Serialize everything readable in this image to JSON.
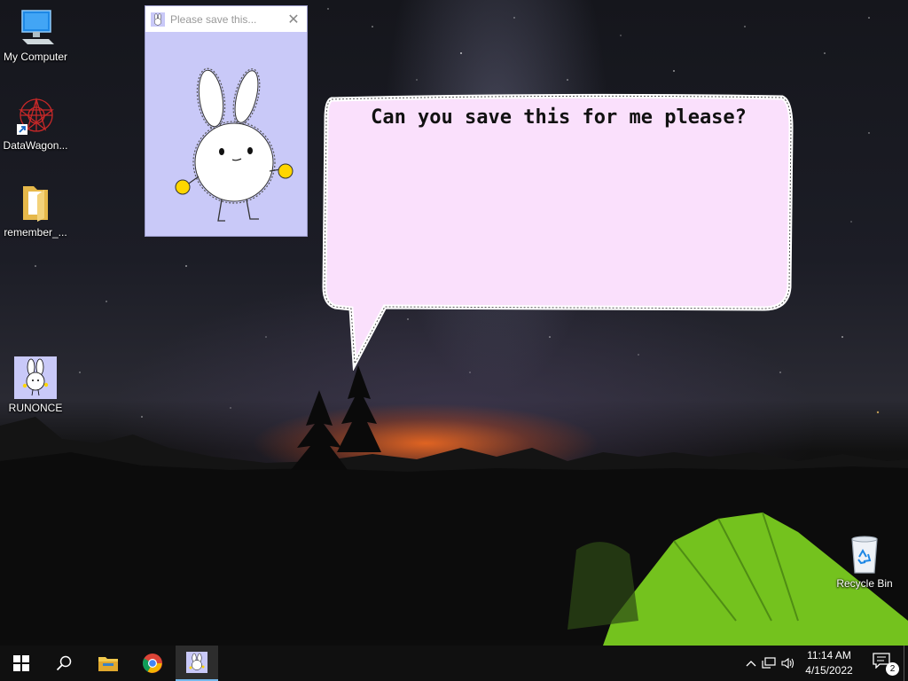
{
  "desktop": {
    "icons": [
      {
        "label": "My Computer",
        "icon": "computer-icon"
      },
      {
        "label": "DataWagon...",
        "icon": "datawagon-shortcut-icon"
      },
      {
        "label": "remember_...",
        "icon": "folder-icon"
      },
      {
        "label": "RUNONCE",
        "icon": "bunny-app-icon"
      },
      {
        "label": "Recycle Bin",
        "icon": "recycle-bin-icon"
      }
    ]
  },
  "bunny_window": {
    "title": "Please save this...",
    "close_symbol": "✕",
    "background": "#c9c9f8"
  },
  "speech_bubble": {
    "text": "Can you save this for me please?",
    "fill": "#fae0fc"
  },
  "taskbar": {
    "apps": [
      {
        "name": "start",
        "icon": "windows-logo-icon"
      },
      {
        "name": "search",
        "icon": "search-icon"
      },
      {
        "name": "file-explorer",
        "icon": "folder-icon"
      },
      {
        "name": "chrome",
        "icon": "chrome-icon"
      },
      {
        "name": "runonce",
        "icon": "bunny-app-icon",
        "active": true
      }
    ],
    "clock": {
      "time": "11:14 AM",
      "date": "4/15/2022"
    },
    "notification_count": "2"
  },
  "colors": {
    "accent": "#76b9ed",
    "taskbar": "#101010",
    "tent": "#7ed321"
  }
}
